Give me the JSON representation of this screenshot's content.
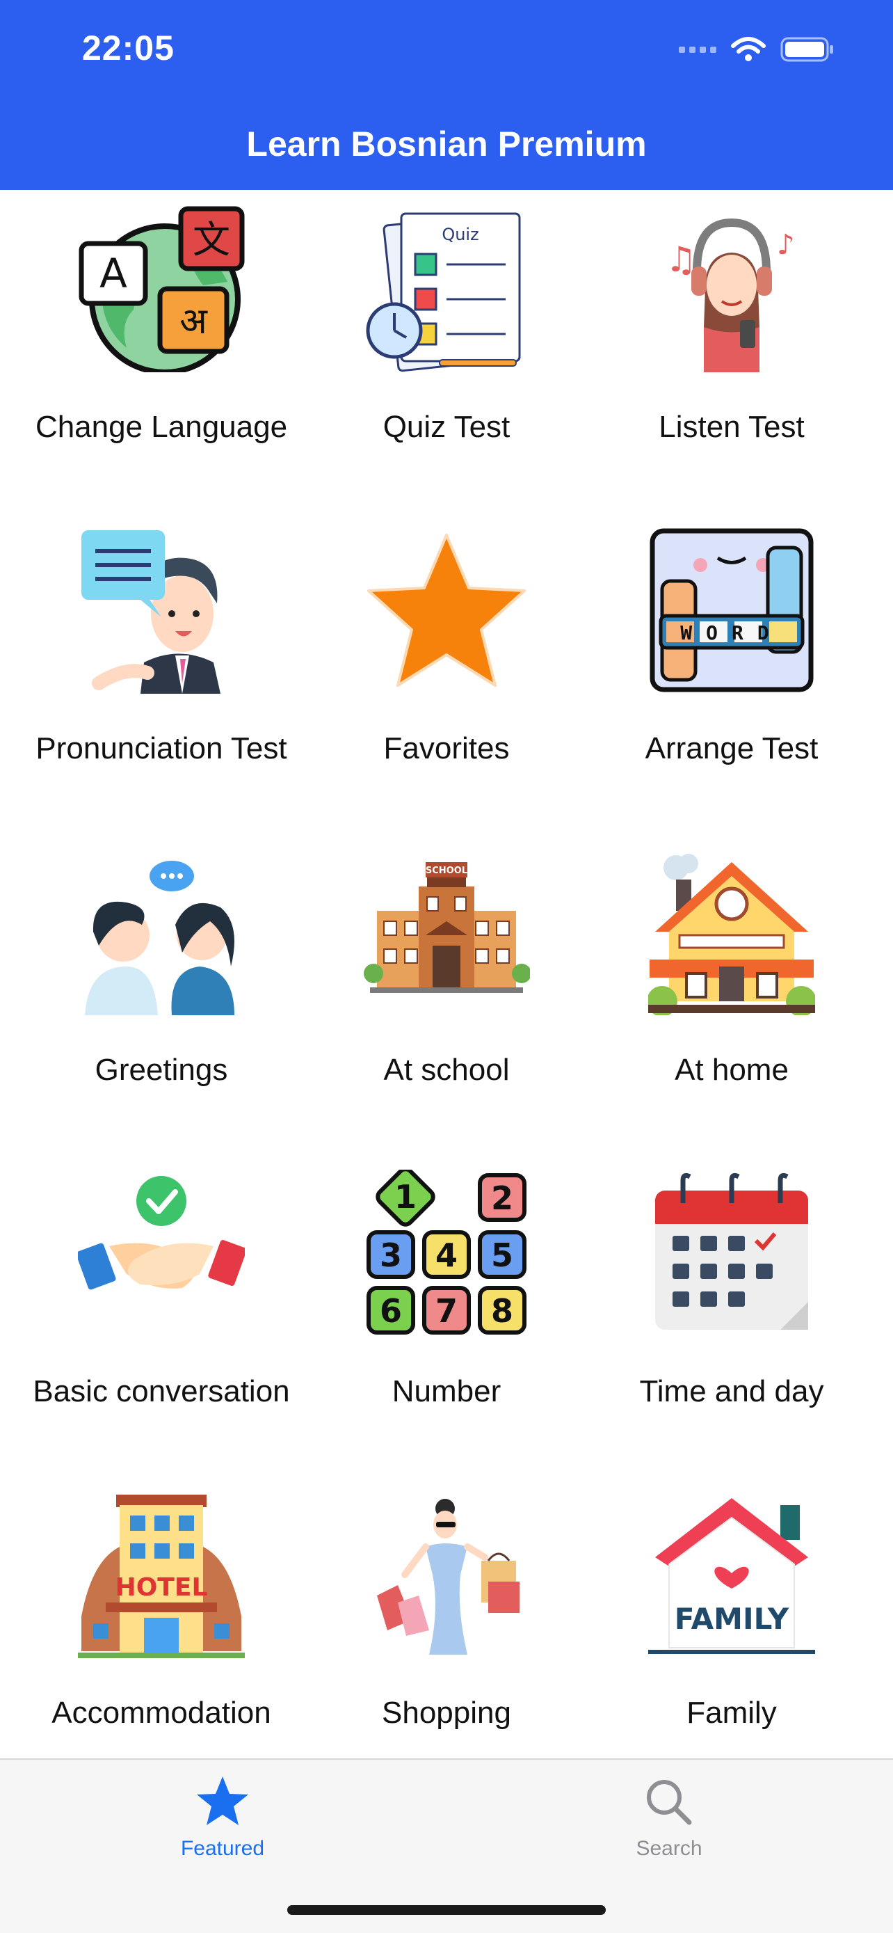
{
  "status_bar": {
    "time": "22:05"
  },
  "header": {
    "title": "Learn Bosnian Premium"
  },
  "menu": [
    {
      "label": "Change Language",
      "icon": "language-globe-icon"
    },
    {
      "label": "Quiz Test",
      "icon": "quiz-clipboard-icon",
      "icon_text": "Quiz"
    },
    {
      "label": "Listen Test",
      "icon": "headphones-listener-icon"
    },
    {
      "label": "Pronunciation Test",
      "icon": "speaking-man-icon"
    },
    {
      "label": "Favorites",
      "icon": "star-icon"
    },
    {
      "label": "Arrange Test",
      "icon": "word-puzzle-icon",
      "icon_text": "WORD"
    },
    {
      "label": "Greetings",
      "icon": "two-people-talking-icon"
    },
    {
      "label": "At school",
      "icon": "school-building-icon",
      "icon_text": "SCHOOL"
    },
    {
      "label": "At home",
      "icon": "house-icon"
    },
    {
      "label": "Basic conversation",
      "icon": "handshake-icon"
    },
    {
      "label": "Number",
      "icon": "number-blocks-icon",
      "icon_text": "12345678"
    },
    {
      "label": "Time and day",
      "icon": "calendar-icon"
    },
    {
      "label": "Accommodation",
      "icon": "hotel-icon",
      "icon_text": "HOTEL"
    },
    {
      "label": "Shopping",
      "icon": "shopping-woman-icon"
    },
    {
      "label": "Family",
      "icon": "family-house-icon",
      "icon_text": "FAMILY"
    }
  ],
  "tabbar": {
    "featured": {
      "label": "Featured",
      "icon": "star-icon",
      "active": true
    },
    "search": {
      "label": "Search",
      "icon": "search-icon",
      "active": false
    }
  },
  "colors": {
    "header": "#2c5ff0",
    "accent": "#1a6ff0",
    "inactive": "#8e8e93"
  }
}
